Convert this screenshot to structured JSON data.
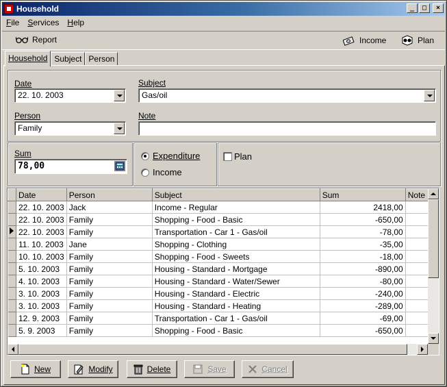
{
  "window": {
    "title": "Household"
  },
  "menu": [
    {
      "label": "File",
      "key": "F"
    },
    {
      "label": "Services",
      "key": "S"
    },
    {
      "label": "Help",
      "key": "H"
    }
  ],
  "toolbar": {
    "report": "Report",
    "income": "Income",
    "plan": "Plan"
  },
  "tabs": [
    "Household",
    "Subject",
    "Person"
  ],
  "form": {
    "date_label": "Date",
    "date_value": "22. 10. 2003",
    "subject_label": "Subject",
    "subject_value": "Gas/oil",
    "person_label": "Person",
    "person_value": "Family",
    "note_label": "Note",
    "note_value": "",
    "sum_label": "Sum",
    "sum_value": "78,00",
    "expenditure_label": "Expenditure",
    "income_label": "Income",
    "plan_label": "Plan",
    "selected_type": "Expenditure",
    "plan_checked": false
  },
  "grid": {
    "columns": [
      "Date",
      "Person",
      "Subject",
      "Sum",
      "Note"
    ],
    "current_row": 2,
    "rows": [
      [
        "22. 10. 2003",
        "Jack",
        "Income - Regular",
        "2418,00",
        ""
      ],
      [
        "22. 10. 2003",
        "Family",
        "Shopping - Food - Basic",
        "-650,00",
        ""
      ],
      [
        "22. 10. 2003",
        "Family",
        "Transportation - Car 1 - Gas/oil",
        "-78,00",
        ""
      ],
      [
        "11. 10. 2003",
        "Jane",
        "Shopping - Clothing",
        "-35,00",
        ""
      ],
      [
        "10. 10. 2003",
        "Family",
        "Shopping - Food - Sweets",
        "-18,00",
        ""
      ],
      [
        "5. 10. 2003",
        "Family",
        "Housing - Standard - Mortgage",
        "-890,00",
        ""
      ],
      [
        "4. 10. 2003",
        "Family",
        "Housing - Standard - Water/Sewer",
        "-80,00",
        ""
      ],
      [
        "3. 10. 2003",
        "Family",
        "Housing - Standard - Electric",
        "-240,00",
        ""
      ],
      [
        "3. 10. 2003",
        "Family",
        "Housing - Standard - Heating",
        "-289,00",
        ""
      ],
      [
        "12. 9. 2003",
        "Family",
        "Transportation - Car 1 - Gas/oil",
        "-69,00",
        ""
      ],
      [
        "5. 9. 2003",
        "Family",
        "Shopping - Food - Basic",
        "-650,00",
        ""
      ]
    ]
  },
  "buttons": {
    "new": "New",
    "modify": "Modify",
    "delete": "Delete",
    "save": "Save",
    "cancel": "Cancel"
  }
}
